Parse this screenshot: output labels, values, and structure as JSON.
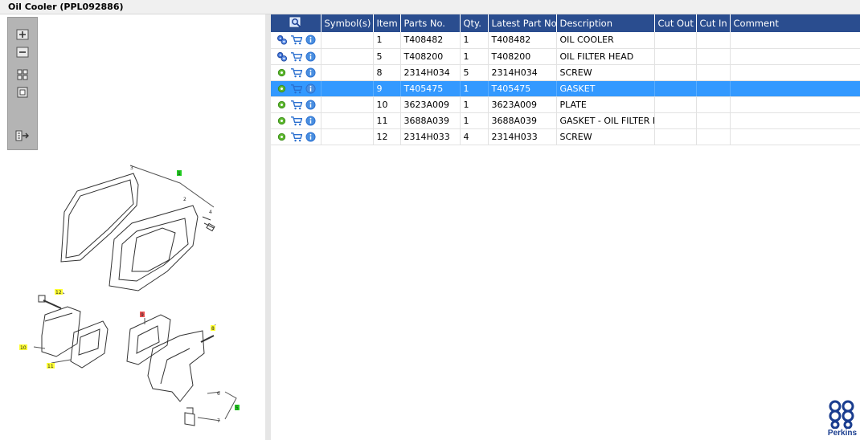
{
  "title": "Oil Cooler (PPL092886)",
  "table": {
    "headers": [
      "",
      "Symbol(s)",
      "Item",
      "Parts No.",
      "Qty.",
      "Latest Part No.",
      "Description",
      "Cut Out",
      "Cut In",
      "Comment"
    ],
    "rows": [
      {
        "item": "1",
        "part": "T408482",
        "qty": "1",
        "latest": "T408482",
        "desc": "OIL COOLER",
        "cut_out": "",
        "cut_in": "",
        "comment": "",
        "gears": "double"
      },
      {
        "item": "5",
        "part": "T408200",
        "qty": "1",
        "latest": "T408200",
        "desc": "OIL FILTER HEAD",
        "cut_out": "",
        "cut_in": "",
        "comment": "",
        "gears": "double"
      },
      {
        "item": "8",
        "part": "2314H034",
        "qty": "5",
        "latest": "2314H034",
        "desc": "SCREW",
        "cut_out": "",
        "cut_in": "",
        "comment": "",
        "gears": "single"
      },
      {
        "item": "9",
        "part": "T405475",
        "qty": "1",
        "latest": "T405475",
        "desc": "GASKET",
        "cut_out": "",
        "cut_in": "",
        "comment": "",
        "gears": "single",
        "selected": true
      },
      {
        "item": "10",
        "part": "3623A009",
        "qty": "1",
        "latest": "3623A009",
        "desc": "PLATE",
        "cut_out": "",
        "cut_in": "",
        "comment": "",
        "gears": "single"
      },
      {
        "item": "11",
        "part": "3688A039",
        "qty": "1",
        "latest": "3688A039",
        "desc": "GASKET - OIL FILTER HEAD",
        "cut_out": "",
        "cut_in": "",
        "comment": "",
        "gears": "single"
      },
      {
        "item": "12",
        "part": "2314H033",
        "qty": "4",
        "latest": "2314H033",
        "desc": "SCREW",
        "cut_out": "",
        "cut_in": "",
        "comment": "",
        "gears": "single"
      }
    ]
  },
  "toolbar": {
    "buttons": [
      "zoom-in-icon",
      "zoom-out-icon",
      "fit-all-icon",
      "actual-size-icon",
      "export-icon"
    ]
  },
  "diagram": {
    "callouts": [
      {
        "label": "1",
        "color": "#22cc22"
      },
      {
        "label": "2"
      },
      {
        "label": "3"
      },
      {
        "label": "4"
      },
      {
        "label": "12",
        "color": "#ffff33"
      },
      {
        "label": "9",
        "color": "#ee5555"
      },
      {
        "label": "8",
        "color": "#ffff33"
      },
      {
        "label": "10",
        "color": "#ffff33"
      },
      {
        "label": "11",
        "color": "#ffff33"
      },
      {
        "label": "6"
      },
      {
        "label": "5",
        "color": "#22cc22"
      },
      {
        "label": "7"
      }
    ]
  },
  "brand": {
    "name": "Perkins",
    "color": "#1a3d8f"
  },
  "colors": {
    "header": "#2a4d8f",
    "selection": "#3399ff"
  }
}
